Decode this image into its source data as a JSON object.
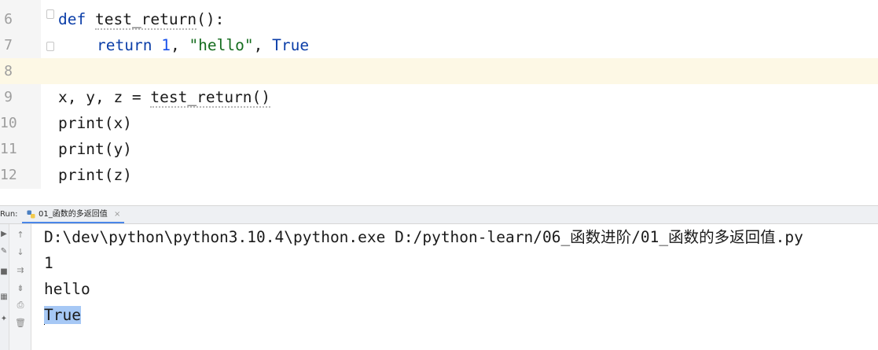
{
  "editor": {
    "lines": [
      {
        "num": "6",
        "text": "def test_return():"
      },
      {
        "num": "7",
        "text": "return 1, \"hello\", True"
      },
      {
        "num": "8",
        "text": ""
      },
      {
        "num": "9",
        "text": "x, y, z = test_return()"
      },
      {
        "num": "10",
        "text": "print(x)"
      },
      {
        "num": "11",
        "text": "print(y)"
      },
      {
        "num": "12",
        "text": "print(z)"
      }
    ],
    "tokens": {
      "def": "def",
      "fn_name": "test_return",
      "parens_colon": "():",
      "ret": "return",
      "ret_num": "1",
      "comma1": ", ",
      "ret_str": "\"hello\"",
      "comma2": ", ",
      "ret_true": "True",
      "assign": "x, y, z = ",
      "call": "test_return()"
    }
  },
  "run_panel": {
    "label": "Run:",
    "tab_title": "01_函数的多返回值",
    "tab_close": "×",
    "output": [
      "D:\\dev\\python\\python3.10.4\\python.exe D:/python-learn/06_函数进阶/01_函数的多返回值.py",
      "1",
      "hello",
      "True"
    ],
    "tool_icons": [
      "up-arrow-icon",
      "down-arrow-icon",
      "soft-wrap-icon",
      "scroll-to-end-icon",
      "print-icon",
      "trash-icon"
    ],
    "left_icons": [
      "rerun-icon",
      "wrench-icon",
      "stop-icon",
      "layout-icon",
      "pin-icon"
    ]
  },
  "colors": {
    "keyword": "#0b3ea8",
    "string": "#146c1e",
    "number": "#1750eb",
    "current_line": "#fdf8e5",
    "selection": "#a6c8f5",
    "tab_underline": "#4a86e8"
  }
}
